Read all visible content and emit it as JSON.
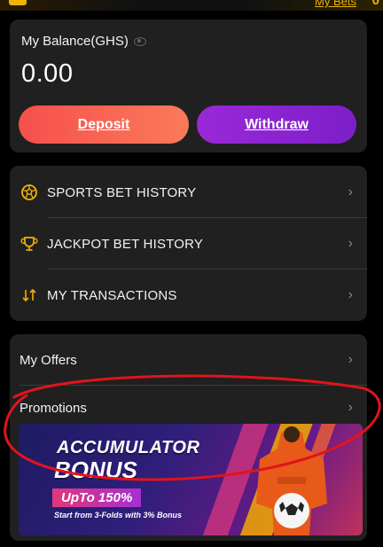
{
  "header": {
    "my_bets_label": "My Bets",
    "count": "0"
  },
  "balance": {
    "label": "My Balance(GHS)",
    "amount": "0.00",
    "deposit_label": "Deposit",
    "withdraw_label": "Withdraw"
  },
  "history": {
    "items": [
      {
        "label": "SPORTS BET HISTORY",
        "icon": "soccer-ball-icon"
      },
      {
        "label": "JACKPOT BET HISTORY",
        "icon": "trophy-icon"
      },
      {
        "label": "MY TRANSACTIONS",
        "icon": "transfer-arrows-icon"
      }
    ]
  },
  "offers": {
    "items": [
      {
        "label": "My Offers"
      },
      {
        "label": "Promotions"
      }
    ],
    "banner": {
      "line1": "ACCUMULATOR",
      "line2": "BONUS",
      "line3": "UpTo 150%",
      "line4": "Start from 3-Folds with 3% Bonus"
    }
  },
  "colors": {
    "accent_gold": "#f2b200",
    "deposit_gradient": "#f6504c",
    "withdraw_gradient": "#9a28d8",
    "annotation_red": "#e0141b"
  }
}
